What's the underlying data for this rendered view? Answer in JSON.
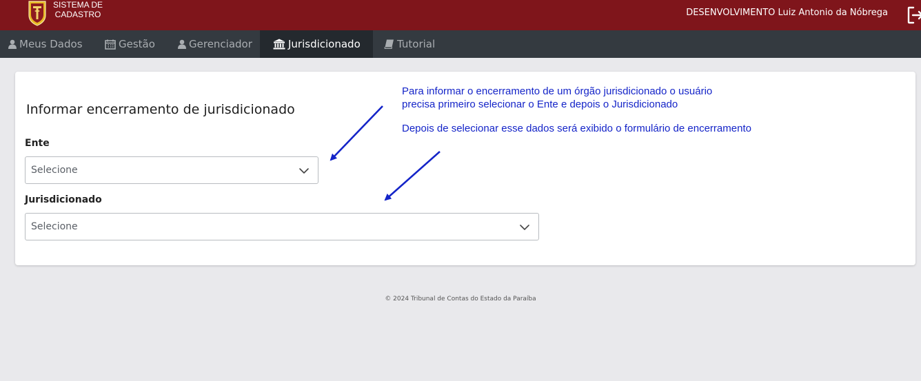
{
  "header": {
    "brand_line1": "SISTEMA DE",
    "brand_line2": "CADASTRO",
    "user": "DESENVOLVIMENTO Luiz Antonio da Nóbrega"
  },
  "nav": {
    "items": [
      {
        "label": "Meus Dados",
        "icon": "user-icon"
      },
      {
        "label": "Gestão",
        "icon": "calendar-icon"
      },
      {
        "label": "Gerenciador",
        "icon": "user-icon"
      },
      {
        "label": "Jurisdicionado",
        "icon": "institution-icon",
        "active": true
      },
      {
        "label": "Tutorial",
        "icon": "book-icon"
      }
    ]
  },
  "form": {
    "title": "Informar encerramento de jurisdicionado",
    "ente_label": "Ente",
    "ente_placeholder": "Selecione",
    "jurisdicionado_label": "Jurisdicionado",
    "jurisdicionado_placeholder": "Selecione"
  },
  "annotation": {
    "line1": "Para informar o encerramento de um órgão jurisdicionado o usuário",
    "line2": "precisa primeiro selecionar o Ente e depois o Jurisdicionado",
    "line3": "Depois de selecionar esse dados será exibido o formulário de encerramento",
    "color": "#1424c8"
  },
  "footer": {
    "text": "© 2024 Tribunal de Contas do Estado da Paraíba"
  },
  "colors": {
    "topbar": "#7f151b",
    "navbar": "#343a40",
    "nav_active": "#24292e"
  }
}
